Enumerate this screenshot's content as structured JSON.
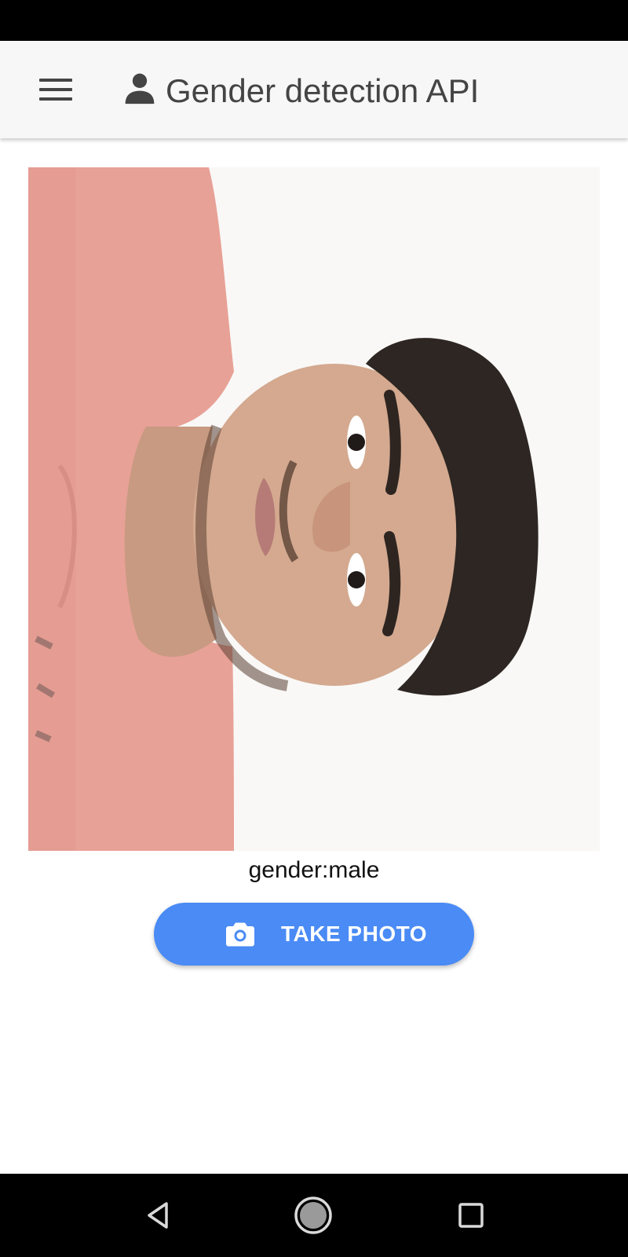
{
  "status_bar": {},
  "app_bar": {
    "title": "Gender detection API",
    "menu_icon": "hamburger-menu-icon",
    "title_icon": "person-icon"
  },
  "photo": {
    "description_icon": "photo",
    "orientation": "rotated"
  },
  "result": {
    "text": "gender:male"
  },
  "take_photo_button": {
    "label": "TAKE PHOTO",
    "icon": "camera-icon"
  },
  "nav_bar": {
    "back_icon": "back-triangle-icon",
    "home_icon": "home-circle-icon",
    "recents_icon": "recents-square-icon"
  },
  "colors": {
    "accent": "#4a8bf5",
    "app_bar_bg": "#f7f7f7",
    "title_text": "#444444"
  }
}
